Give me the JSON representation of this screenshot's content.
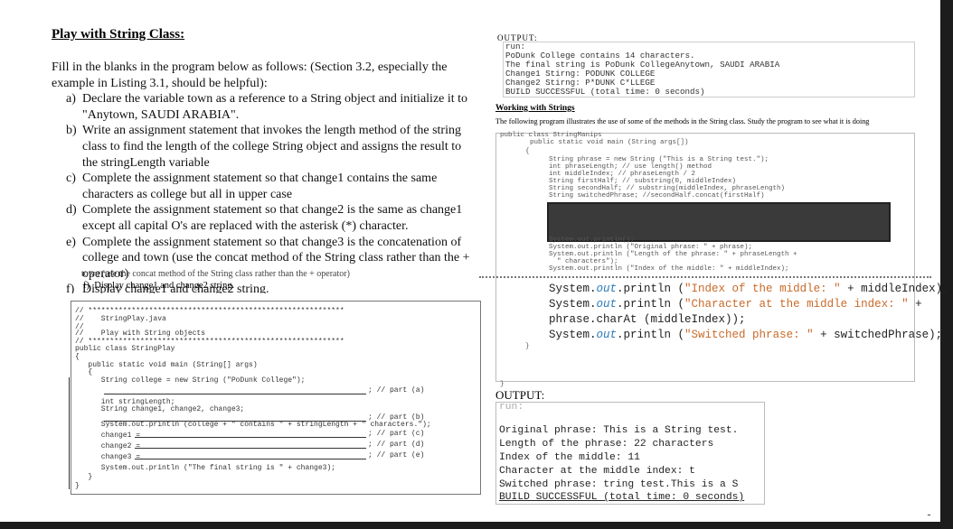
{
  "title": "Play with String Class:",
  "intro": "Fill in the blanks in the program below as follows: (Section 3.2, especially the example in Listing 3.1, should be helpful):",
  "tasks": [
    {
      "label": "a)",
      "text": "Declare the variable town as a reference to a String object and initialize it to \"Anytown, SAUDI ARABIA\"."
    },
    {
      "label": "b)",
      "text": "Write an assignment statement that invokes the length method of the string class to find the length of the college String object and assigns the result to the stringLength variable"
    },
    {
      "label": "c)",
      "text": "Complete the assignment statement so that change1 contains the same characters as college but all in upper case"
    },
    {
      "label": "d)",
      "text": "Complete the assignment statement so that change2 is the same as change1 except all capital O's are replaced with the asterisk (*) character."
    },
    {
      "label": "e)",
      "text": "Complete the assignment statement so that change3 is the concatenation of college and town (use the concat method of the String class rather than the + operator)"
    },
    {
      "label": "f)",
      "text": "Display change1 and change2 string."
    }
  ],
  "bleed_text": "town (use the concat method of the String class rather than the + operator)",
  "sub_f": "f)  Display change1 and change2 string.",
  "program": {
    "lines": [
      "// ***********************************************************",
      "//    StringPlay.java",
      "//",
      "//    Play with String objects",
      "// ***********************************************************",
      "public class StringPlay",
      "{",
      "   public static void main (String[] args)",
      "   {",
      "      String college = new String (\"PoDunk College\");",
      "",
      "      int stringLength;",
      "      String change1, change2, change3;",
      "",
      "      System.out.println (college + \" contains \" + stringLength + \" characters.\");",
      "      change1 =",
      "      change2 =",
      "      change3 =",
      "      System.out.println (\"The final string is \" + change3);",
      "   }",
      "}"
    ],
    "blank_suffixes": [
      "; // part (a)",
      "; // part (b)",
      "; // part (c)",
      "; // part (d)",
      "; // part (e)"
    ]
  },
  "output1": {
    "header": "OUTPUT:",
    "lines": [
      "run:",
      "PoDunk College contains 14 characters.",
      "The final string is PoDunk CollegeAnytown, SAUDI ARABIA",
      "Change1 Stirng: PODUNK COLLEGE",
      "Change2 Stirng: P*DUNK C*LLEGE",
      "BUILD SUCCESSFUL (total time: 0 seconds)"
    ]
  },
  "working": {
    "title": "Working with Strings",
    "desc": "The following program illustrates the use of some of the methods in the String class. Study the program to see what it is doing",
    "header_lines": [
      "public class StringManips",
      "  public static void main (String args[])",
      "{"
    ],
    "code_lines": [
      "String phrase = new String (\"This is a String test.\");",
      "int phraseLength; // use length() method",
      "int middleIndex; // phraseLength / 2",
      "String firstHalf; // substring(0, middleIndex)",
      "String secondHalf; // substring(middleIndex, phraseLength)",
      "String switchedPhrase; //secondHalf.concat(firstHalf)"
    ],
    "print_lines": [
      "System.out.println();",
      "System.out.println (\"Original phrase: \" + phrase);",
      "System.out.println (\"Length of the phrase: \" + phraseLength +",
      "  \" characters\");",
      "System.out.println (\"Index of the middle: \" + middleIndex);"
    ],
    "zoom_lines": [
      {
        "a": "System.",
        "b": "out",
        "c": ".println (",
        "d": "\"Index of the middle: \"",
        "e": " + middleIndex);"
      },
      {
        "a": "System.",
        "b": "out",
        "c": ".println (",
        "d": "\"Character at the middle index: \"",
        "e": " +"
      },
      {
        "a": "phrase.charAt (middleIndex));",
        "b": "",
        "c": "",
        "d": "",
        "e": ""
      },
      {
        "a": "System.",
        "b": "out",
        "c": ".println (",
        "d": "\"Switched phrase: \"",
        "e": " + switchedPhrase);"
      }
    ],
    "closing": [
      "}",
      "}"
    ]
  },
  "output2": {
    "label": "OUTPUT:",
    "lines": [
      "run:",
      "",
      "Original phrase: This is a String test.",
      "Length of the phrase: 22 characters",
      "Index of the middle: 11",
      "Character at the middle index: t",
      "Switched phrase: tring test.This is a S",
      "BUILD SUCCESSFUL (total time: 0 seconds)"
    ]
  },
  "corner_mark": "ـ"
}
